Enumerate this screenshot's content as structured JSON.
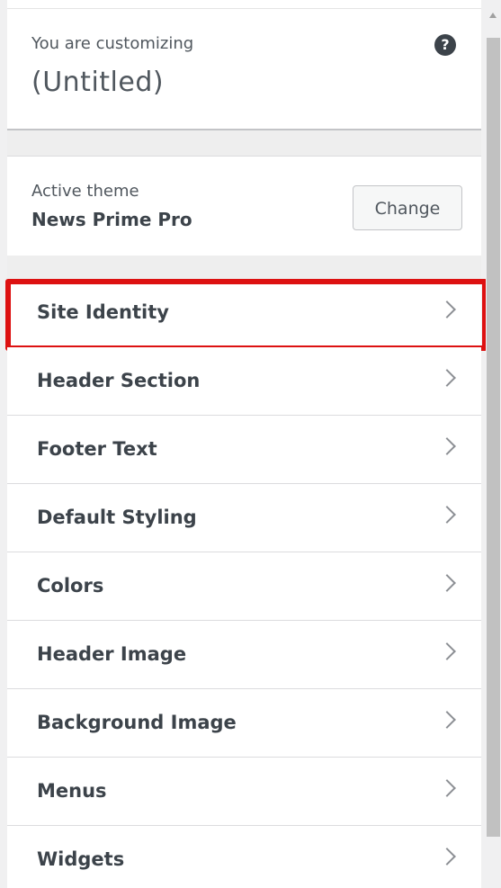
{
  "customizing": {
    "label": "You are customizing",
    "title": "(Untitled)",
    "help_icon": "question-circle-icon"
  },
  "theme": {
    "label": "Active theme",
    "name": "News Prime Pro",
    "change_label": "Change"
  },
  "sections": [
    {
      "label": "Site Identity",
      "highlighted": true
    },
    {
      "label": "Header Section"
    },
    {
      "label": "Footer Text"
    },
    {
      "label": "Default Styling"
    },
    {
      "label": "Colors"
    },
    {
      "label": "Header Image"
    },
    {
      "label": "Background Image"
    },
    {
      "label": "Menus"
    },
    {
      "label": "Widgets"
    }
  ],
  "colors": {
    "highlight": "#dd1111",
    "text_dark": "#3c434a",
    "text_muted": "#50575e"
  }
}
